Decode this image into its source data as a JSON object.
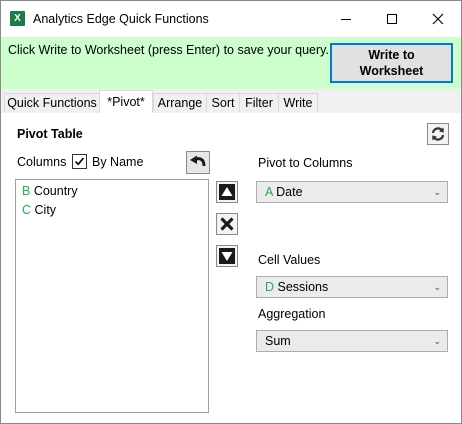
{
  "window": {
    "icon_text": "X",
    "title": "Analytics Edge Quick Functions"
  },
  "banner": {
    "message": "Click Write to Worksheet (press Enter) to save your query.",
    "write_button": "Write to Worksheet",
    "background_color": "#ccffcc"
  },
  "tabs": [
    {
      "label": "Quick Functions",
      "active": false
    },
    {
      "label": "*Pivot*",
      "active": true
    },
    {
      "label": "Arrange",
      "active": false
    },
    {
      "label": "Sort",
      "active": false
    },
    {
      "label": "Filter",
      "active": false
    },
    {
      "label": "Write",
      "active": false
    }
  ],
  "pivot": {
    "section_title": "Pivot Table",
    "columns_label": "Columns",
    "by_name_label": "By Name",
    "by_name_checked": true,
    "columns_list": [
      {
        "letter": "B",
        "name": "Country"
      },
      {
        "letter": "C",
        "name": "City"
      }
    ],
    "pivot_to_columns_label": "Pivot to Columns",
    "pivot_to_columns_value": {
      "letter": "A",
      "name": "Date"
    },
    "cell_values_label": "Cell Values",
    "cell_values_value": {
      "letter": "D",
      "name": "Sessions"
    },
    "aggregation_label": "Aggregation",
    "aggregation_value": "Sum",
    "letter_color": "#22b14c"
  },
  "icons": {
    "minimize": "minimize-icon",
    "maximize": "maximize-icon",
    "close": "close-icon",
    "refresh": "refresh-icon",
    "undo": "undo-icon",
    "move_up": "arrow-up-icon",
    "remove": "remove-x-icon",
    "move_down": "arrow-down-icon",
    "dropdown": "chevron-down-icon"
  }
}
